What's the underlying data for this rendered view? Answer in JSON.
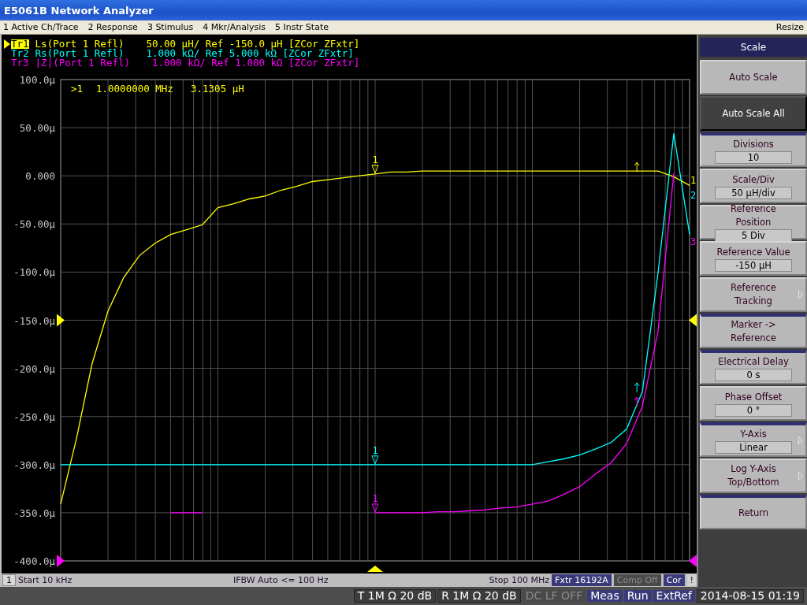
{
  "window": {
    "title": "E5061B Network Analyzer"
  },
  "menu": {
    "items": [
      "1 Active Ch/Trace",
      "2 Response",
      "3 Stimulus",
      "4 Mkr/Analysis",
      "5 Instr State"
    ],
    "resize": "Resize"
  },
  "traces": [
    {
      "parameter": "Ls(Port 1 Refl)",
      "scale": "50.00 µH/ Ref -150.0 µH [ZCor ZFxtr]",
      "selected": true,
      "marker": "1",
      "end_label": "1",
      "ref_arrow": true
    },
    {
      "parameter": "Rs(Port 1 Refl)",
      "scale": "1.000 kΩ/ Ref 5.000 kΩ [ZCor ZFxtr]",
      "selected": false,
      "marker": "1",
      "end_label": "2",
      "ref_arrow": false
    },
    {
      "parameter": "|Z|(Port 1 Refl)",
      "scale": "1.000 kΩ/ Ref 1.000 kΩ [ZCor ZFxtr]",
      "selected": false,
      "marker": "1",
      "end_label": "3",
      "ref_arrow": true
    }
  ],
  "marker_readout": {
    "marker": ">1",
    "frequency": "1.0000000 MHz",
    "value": "3.1305 µH"
  },
  "chart_data": {
    "type": "line",
    "categories": [
      null,
      null,
      null,
      null,
      null,
      null,
      null,
      null,
      null,
      null,
      null,
      null,
      null,
      null,
      null,
      null,
      null,
      null,
      null,
      null,
      null,
      null,
      null,
      null,
      null,
      null,
      null,
      null,
      null,
      null,
      null,
      null,
      null,
      null,
      null,
      null,
      null,
      null,
      null,
      null,
      null
    ],
    "ylim": [
      -400,
      100
    ],
    "grid": true,
    "yticks": [
      {
        "value": 100,
        "label": "100.0µ"
      },
      {
        "value": 50,
        "label": "50.00µ"
      },
      {
        "value": 0,
        "label": "0.000"
      },
      {
        "value": -50,
        "label": "-50.00µ"
      },
      {
        "value": -100,
        "label": "-100.0µ"
      },
      {
        "value": -150,
        "label": "-150.0µ"
      },
      {
        "value": -200,
        "label": "-200.0µ"
      },
      {
        "value": -250,
        "label": "-250.0µ"
      },
      {
        "value": -300,
        "label": "-300.0µ"
      },
      {
        "value": -350,
        "label": "-350.0µ"
      },
      {
        "value": -400,
        "label": "-400.0µ"
      }
    ],
    "series": [
      {
        "name": "Tr1",
        "color": "#ffff00",
        "values": [
          -341,
          -273,
          -195,
          -141,
          -106,
          -83,
          -70,
          -61,
          -56,
          -51,
          -33,
          -29,
          -24,
          -21,
          -15,
          -11,
          -6,
          -4,
          -2,
          0,
          2,
          4,
          4,
          5,
          5,
          5,
          5,
          5,
          5,
          5,
          5,
          5,
          5,
          5,
          5,
          5,
          5,
          5,
          5,
          -1,
          -10
        ]
      },
      {
        "name": "Tr2",
        "color": "#00ffff",
        "values": [
          -300,
          -300,
          -300,
          -300,
          -300,
          -300,
          -300,
          -300,
          -300,
          -300,
          -300,
          -300,
          -300,
          -300,
          -300,
          -300,
          -300,
          -300,
          -300,
          -300,
          -300,
          -300,
          -300,
          -300,
          -300,
          -300,
          -300,
          -300,
          -300,
          -300,
          -300,
          -297,
          -294,
          -290,
          -284,
          -277,
          -263,
          -224,
          -100,
          44,
          -61
        ]
      },
      {
        "name": "Tr3",
        "color": "#ff00ff",
        "values": [
          null,
          null,
          null,
          null,
          null,
          null,
          null,
          -350,
          -350,
          -350,
          null,
          null,
          null,
          null,
          null,
          null,
          null,
          null,
          null,
          null,
          -350,
          -350,
          -350,
          -350,
          -349,
          -349,
          -348,
          -347,
          -345,
          -344,
          -341,
          -338,
          -331,
          -323,
          -310,
          -298,
          -278,
          -239,
          -161,
          3,
          null
        ]
      }
    ]
  },
  "status_bar": {
    "channel": "1",
    "start": "Start 10 kHz",
    "ifbw": "IFBW Auto <= 100 Hz",
    "stop": "Stop 100 MHz",
    "flags": [
      {
        "text": "Fxtr 16192A",
        "kind": "active"
      },
      {
        "text": "Comp Off",
        "kind": "disabled"
      },
      {
        "text": "Cor",
        "kind": "active"
      },
      {
        "text": "!",
        "kind": "plain"
      }
    ]
  },
  "softkeys": {
    "title": "Scale",
    "items": [
      {
        "kind": "action",
        "label": "Auto Scale",
        "selected": false,
        "group_start": false
      },
      {
        "kind": "action",
        "label": "Auto Scale All",
        "selected": true,
        "group_start": false
      },
      {
        "kind": "value",
        "label": "Divisions",
        "value": "10",
        "selected": false,
        "group_start": true
      },
      {
        "kind": "value",
        "label": "Scale/Div",
        "value": "50 µH/div",
        "selected": false,
        "group_start": false
      },
      {
        "kind": "value",
        "label": "Reference Position",
        "value": "5 Div",
        "selected": false,
        "group_start": false
      },
      {
        "kind": "value",
        "label": "Reference Value",
        "value": "-150 µH",
        "selected": false,
        "group_start": false
      },
      {
        "kind": "submenu",
        "label": "Reference Tracking",
        "selected": false,
        "group_start": false
      },
      {
        "kind": "action",
        "label": "Marker -> Reference",
        "selected": false,
        "group_start": true
      },
      {
        "kind": "value",
        "label": "Electrical Delay",
        "value": "0 s",
        "selected": false,
        "group_start": true
      },
      {
        "kind": "value",
        "label": "Phase Offset",
        "value": "0 °",
        "selected": false,
        "group_start": false
      },
      {
        "kind": "submenu_value",
        "label": "Y-Axis",
        "value": "Linear",
        "selected": false,
        "group_start": true
      },
      {
        "kind": "submenu",
        "label": "Log Y-Axis Top/Bottom",
        "selected": false,
        "group_start": false
      },
      {
        "kind": "action",
        "label": "Return",
        "selected": false,
        "group_start": true
      }
    ]
  },
  "bottom_bar": [
    {
      "text": "T 1M Ω 20 dB",
      "kind": "plain"
    },
    {
      "text": "R 1M Ω 20 dB",
      "kind": "plain"
    },
    {
      "text": "DC LF OFF",
      "kind": "disabled"
    },
    {
      "text": "Meas",
      "kind": "active"
    },
    {
      "text": "Run",
      "kind": "active"
    },
    {
      "text": "ExtRef",
      "kind": "active"
    },
    {
      "text": "2014-08-15 01:19",
      "kind": "plain"
    }
  ]
}
